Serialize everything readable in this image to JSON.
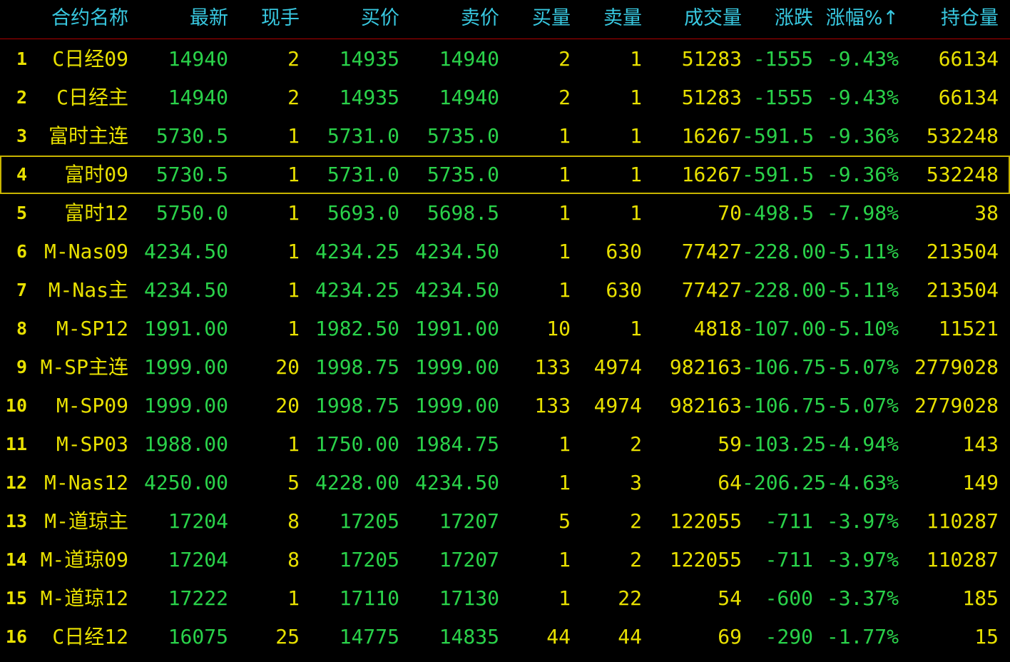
{
  "colors": {
    "background": "#000000",
    "header_text": "#38c8e0",
    "header_divider": "#b00000",
    "down_green": "#2ad24a",
    "neutral_yellow": "#e8e000",
    "selection_outline": "#c8b400"
  },
  "header": {
    "name": "合约名称",
    "last": "最新",
    "cur_vol": "现手",
    "bid": "买价",
    "ask": "卖价",
    "bid_vol": "买量",
    "ask_vol": "卖量",
    "volume": "成交量",
    "change": "涨跌",
    "change_pct": "涨幅%↑",
    "open_interest": "持仓量"
  },
  "selected_row": 4,
  "rows": [
    {
      "idx": "1",
      "name": "C日经09",
      "last": "14940",
      "cur_vol": "2",
      "bid": "14935",
      "ask": "14940",
      "bid_vol": "2",
      "ask_vol": "1",
      "volume": "51283",
      "change": "-1555",
      "change_pct": "-9.43%",
      "open_interest": "66134"
    },
    {
      "idx": "2",
      "name": "C日经主",
      "last": "14940",
      "cur_vol": "2",
      "bid": "14935",
      "ask": "14940",
      "bid_vol": "2",
      "ask_vol": "1",
      "volume": "51283",
      "change": "-1555",
      "change_pct": "-9.43%",
      "open_interest": "66134"
    },
    {
      "idx": "3",
      "name": "富时主连",
      "last": "5730.5",
      "cur_vol": "1",
      "bid": "5731.0",
      "ask": "5735.0",
      "bid_vol": "1",
      "ask_vol": "1",
      "volume": "16267",
      "change": "-591.5",
      "change_pct": "-9.36%",
      "open_interest": "532248"
    },
    {
      "idx": "4",
      "name": "富时09",
      "last": "5730.5",
      "cur_vol": "1",
      "bid": "5731.0",
      "ask": "5735.0",
      "bid_vol": "1",
      "ask_vol": "1",
      "volume": "16267",
      "change": "-591.5",
      "change_pct": "-9.36%",
      "open_interest": "532248"
    },
    {
      "idx": "5",
      "name": "富时12",
      "last": "5750.0",
      "cur_vol": "1",
      "bid": "5693.0",
      "ask": "5698.5",
      "bid_vol": "1",
      "ask_vol": "1",
      "volume": "70",
      "change": "-498.5",
      "change_pct": "-7.98%",
      "open_interest": "38"
    },
    {
      "idx": "6",
      "name": "M-Nas09",
      "last": "4234.50",
      "cur_vol": "1",
      "bid": "4234.25",
      "ask": "4234.50",
      "bid_vol": "1",
      "ask_vol": "630",
      "volume": "77427",
      "change": "-228.00",
      "change_pct": "-5.11%",
      "open_interest": "213504"
    },
    {
      "idx": "7",
      "name": "M-Nas主",
      "last": "4234.50",
      "cur_vol": "1",
      "bid": "4234.25",
      "ask": "4234.50",
      "bid_vol": "1",
      "ask_vol": "630",
      "volume": "77427",
      "change": "-228.00",
      "change_pct": "-5.11%",
      "open_interest": "213504"
    },
    {
      "idx": "8",
      "name": "M-SP12",
      "last": "1991.00",
      "cur_vol": "1",
      "bid": "1982.50",
      "ask": "1991.00",
      "bid_vol": "10",
      "ask_vol": "1",
      "volume": "4818",
      "change": "-107.00",
      "change_pct": "-5.10%",
      "open_interest": "11521"
    },
    {
      "idx": "9",
      "name": "M-SP主连",
      "last": "1999.00",
      "cur_vol": "20",
      "bid": "1998.75",
      "ask": "1999.00",
      "bid_vol": "133",
      "ask_vol": "4974",
      "volume": "982163",
      "change": "-106.75",
      "change_pct": "-5.07%",
      "open_interest": "2779028"
    },
    {
      "idx": "10",
      "name": "M-SP09",
      "last": "1999.00",
      "cur_vol": "20",
      "bid": "1998.75",
      "ask": "1999.00",
      "bid_vol": "133",
      "ask_vol": "4974",
      "volume": "982163",
      "change": "-106.75",
      "change_pct": "-5.07%",
      "open_interest": "2779028"
    },
    {
      "idx": "11",
      "name": "M-SP03",
      "last": "1988.00",
      "cur_vol": "1",
      "bid": "1750.00",
      "ask": "1984.75",
      "bid_vol": "1",
      "ask_vol": "2",
      "volume": "59",
      "change": "-103.25",
      "change_pct": "-4.94%",
      "open_interest": "143"
    },
    {
      "idx": "12",
      "name": "M-Nas12",
      "last": "4250.00",
      "cur_vol": "5",
      "bid": "4228.00",
      "ask": "4234.50",
      "bid_vol": "1",
      "ask_vol": "3",
      "volume": "64",
      "change": "-206.25",
      "change_pct": "-4.63%",
      "open_interest": "149"
    },
    {
      "idx": "13",
      "name": "M-道琼主",
      "last": "17204",
      "cur_vol": "8",
      "bid": "17205",
      "ask": "17207",
      "bid_vol": "5",
      "ask_vol": "2",
      "volume": "122055",
      "change": "-711",
      "change_pct": "-3.97%",
      "open_interest": "110287"
    },
    {
      "idx": "14",
      "name": "M-道琼09",
      "last": "17204",
      "cur_vol": "8",
      "bid": "17205",
      "ask": "17207",
      "bid_vol": "1",
      "ask_vol": "2",
      "volume": "122055",
      "change": "-711",
      "change_pct": "-3.97%",
      "open_interest": "110287"
    },
    {
      "idx": "15",
      "name": "M-道琼12",
      "last": "17222",
      "cur_vol": "1",
      "bid": "17110",
      "ask": "17130",
      "bid_vol": "1",
      "ask_vol": "22",
      "volume": "54",
      "change": "-600",
      "change_pct": "-3.37%",
      "open_interest": "185"
    },
    {
      "idx": "16",
      "name": "C日经12",
      "last": "16075",
      "cur_vol": "25",
      "bid": "14775",
      "ask": "14835",
      "bid_vol": "44",
      "ask_vol": "44",
      "volume": "69",
      "change": "-290",
      "change_pct": "-1.77%",
      "open_interest": "15"
    }
  ]
}
